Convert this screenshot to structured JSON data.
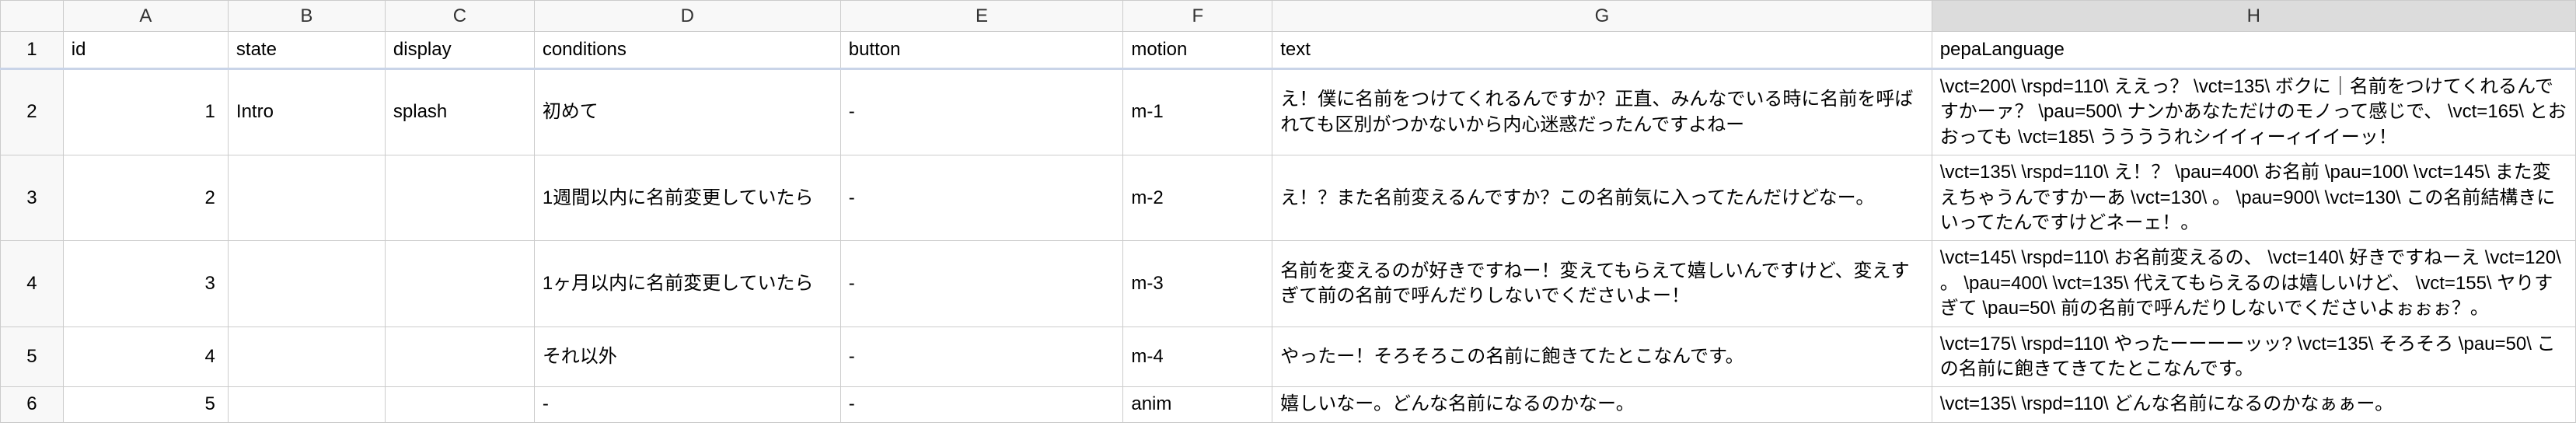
{
  "columns": [
    "A",
    "B",
    "C",
    "D",
    "E",
    "F",
    "G",
    "H"
  ],
  "rowNumbers": [
    "1",
    "2",
    "3",
    "4",
    "5",
    "6"
  ],
  "selectedCol": "H",
  "headers": {
    "A": "id",
    "B": "state",
    "C": "display",
    "D": "conditions",
    "E": "button",
    "F": "motion",
    "G": "text",
    "H": "pepaLanguage"
  },
  "rows": [
    {
      "id": "1",
      "state": "Intro",
      "display": "splash",
      "conditions": "初めて",
      "button": "-",
      "motion": "m-1",
      "text": "え！僕に名前をつけてくれるんですか？正直、みんなでいる時に名前を呼ばれても区別がつかないから内心迷惑だったんですよねー",
      "pepa": "\\vct=200\\ \\rspd=110\\ ええっ？ \\vct=135\\ ボクに｜名前をつけてくれるんですかーァ？ \\pau=500\\ ナンかあなただけのモノって感じで、 \\vct=165\\ とおおっても \\vct=185\\ ううううれシイイィーィイイーッ！"
    },
    {
      "id": "2",
      "state": "",
      "display": "",
      "conditions": "1週間以内に名前変更していたら",
      "button": "-",
      "motion": "m-2",
      "text": "え！？また名前変えるんですか？この名前気に入ってたんだけどなー。",
      "pepa": "\\vct=135\\ \\rspd=110\\ え！？ \\pau=400\\ お名前 \\pau=100\\ \\vct=145\\ また変えちゃうんですかーあ \\vct=130\\ 。 \\pau=900\\ \\vct=130\\ この名前結構きにいってたんですけどネーェ！。"
    },
    {
      "id": "3",
      "state": "",
      "display": "",
      "conditions": "1ヶ月以内に名前変更していたら",
      "button": "-",
      "motion": "m-3",
      "text": "名前を変えるのが好きですねー！変えてもらえて嬉しいんですけど、変えすぎて前の名前で呼んだりしないでくださいよー！",
      "pepa": "\\vct=145\\ \\rspd=110\\ お名前変えるの、 \\vct=140\\ 好きですねーえ \\vct=120\\ 。 \\pau=400\\ \\vct=135\\ 代えてもらえるのは嬉しいけど、 \\vct=155\\ ヤりすぎて \\pau=50\\ 前の名前で呼んだりしないでくださいよぉぉぉ？。"
    },
    {
      "id": "4",
      "state": "",
      "display": "",
      "conditions": "それ以外",
      "button": "-",
      "motion": "m-4",
      "text": "やったー！そろそろこの名前に飽きてたとこなんです。",
      "pepa": "\\vct=175\\ \\rspd=110\\ やったーーーーッッ? \\vct=135\\ そろそろ \\pau=50\\ この名前に飽きてきてたとこなんです。"
    },
    {
      "id": "5",
      "state": "",
      "display": "",
      "conditions": "-",
      "button": "-",
      "motion": "anim",
      "text": "嬉しいなー。どんな名前になるのかなー。",
      "pepa": "\\vct=135\\ \\rspd=110\\ どんな名前になるのかなぁぁー。"
    }
  ]
}
